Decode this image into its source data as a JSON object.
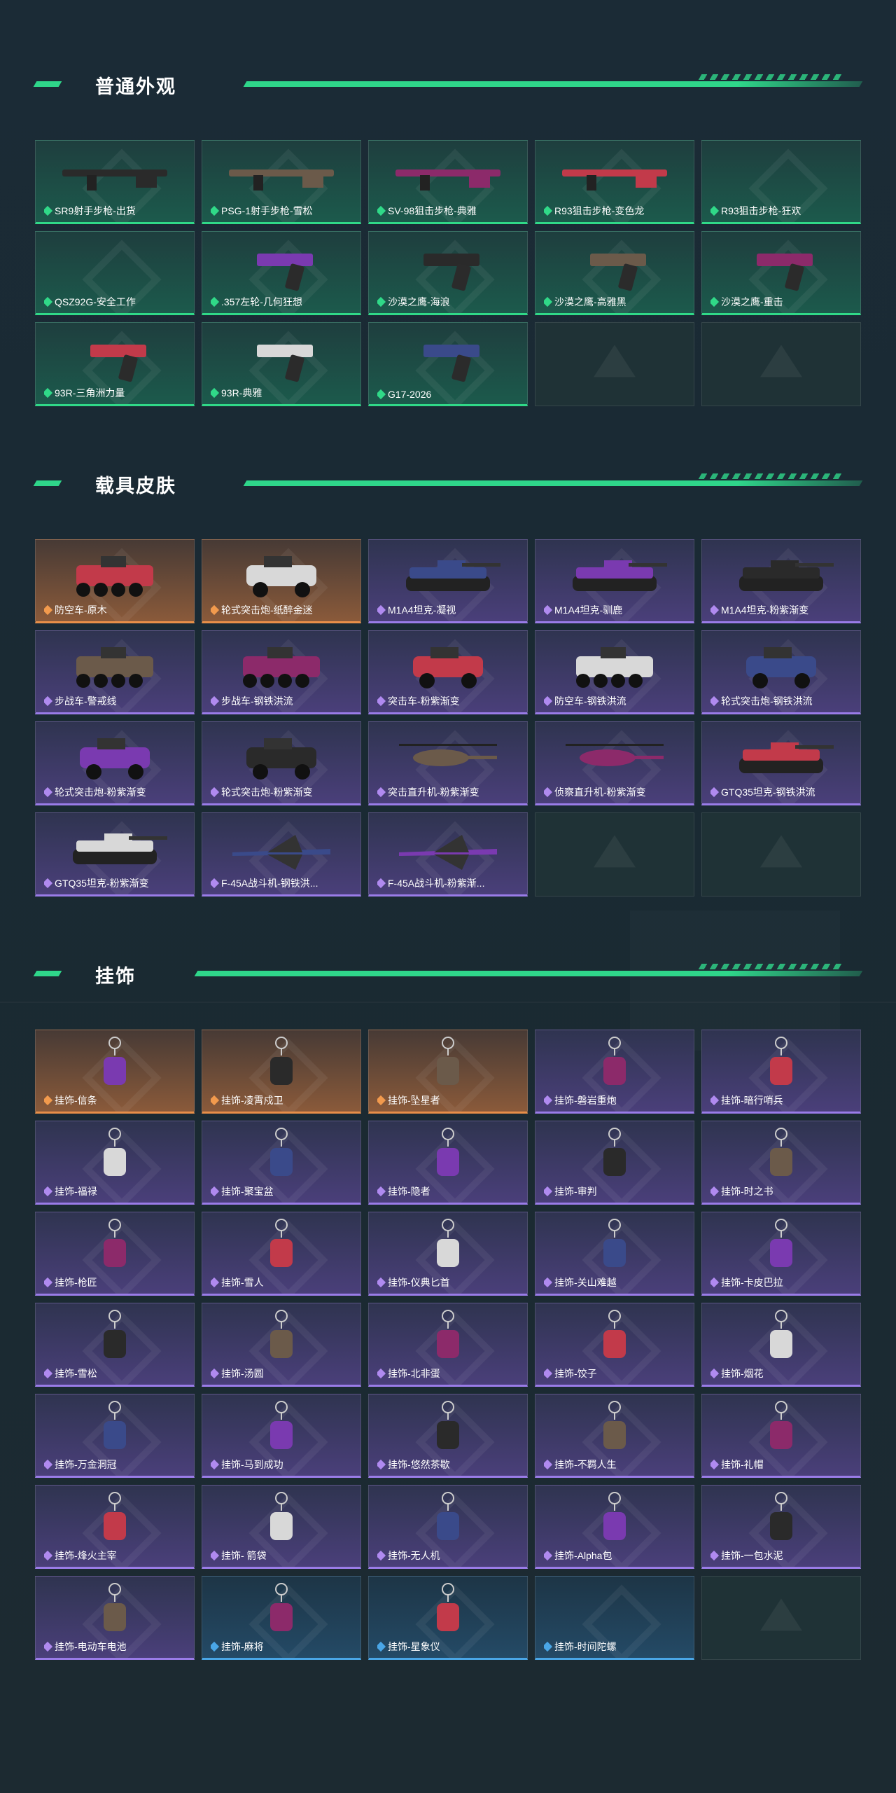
{
  "sections": [
    {
      "title": "普通外观",
      "items": [
        {
          "label": "SR9射手步枪-出货",
          "rarity": "green",
          "art": "rifle"
        },
        {
          "label": "PSG-1射手步枪-雪松",
          "rarity": "green",
          "art": "rifle"
        },
        {
          "label": "SV-98狙击步枪-典雅",
          "rarity": "green",
          "art": "rifle"
        },
        {
          "label": "R93狙击步枪-变色龙",
          "rarity": "green",
          "art": "rifle"
        },
        {
          "label": "R93狙击步枪-狂欢",
          "rarity": "green",
          "art": "none"
        },
        {
          "label": "QSZ92G-安全工作",
          "rarity": "green",
          "art": "none"
        },
        {
          "label": ".357左轮-几何狂想",
          "rarity": "green",
          "art": "pistol"
        },
        {
          "label": "沙漠之鹰-海浪",
          "rarity": "green",
          "art": "pistol"
        },
        {
          "label": "沙漠之鹰-高雅黑",
          "rarity": "green",
          "art": "pistol"
        },
        {
          "label": "沙漠之鹰-重击",
          "rarity": "green",
          "art": "pistol"
        },
        {
          "label": "93R-三角洲力量",
          "rarity": "green",
          "art": "pistol"
        },
        {
          "label": "93R-典雅",
          "rarity": "green",
          "art": "pistol"
        },
        {
          "label": "G17-2026",
          "rarity": "green",
          "art": "pistol"
        },
        {
          "label": "",
          "rarity": "empty",
          "art": "none"
        },
        {
          "label": "",
          "rarity": "empty",
          "art": "none"
        }
      ]
    },
    {
      "title": "载具皮肤",
      "items": [
        {
          "label": "防空车-原木",
          "rarity": "orange",
          "art": "apc"
        },
        {
          "label": "轮式突击炮-纸醉金迷",
          "rarity": "orange",
          "art": "car"
        },
        {
          "label": "M1A4坦克-凝视",
          "rarity": "purple",
          "art": "tank"
        },
        {
          "label": "M1A4坦克-驯鹿",
          "rarity": "purple",
          "art": "tank"
        },
        {
          "label": "M1A4坦克-粉紫渐变",
          "rarity": "purple",
          "art": "tank"
        },
        {
          "label": "步战车-警戒线",
          "rarity": "purple",
          "art": "apc"
        },
        {
          "label": "步战车-钢铁洪流",
          "rarity": "purple",
          "art": "apc"
        },
        {
          "label": "突击车-粉紫渐变",
          "rarity": "purple",
          "art": "car"
        },
        {
          "label": "防空车-钢铁洪流",
          "rarity": "purple",
          "art": "apc"
        },
        {
          "label": "轮式突击炮-钢铁洪流",
          "rarity": "purple",
          "art": "car"
        },
        {
          "label": "轮式突击炮-粉紫渐变",
          "rarity": "purple",
          "art": "car"
        },
        {
          "label": "轮式突击炮-粉紫渐变",
          "rarity": "purple",
          "art": "car"
        },
        {
          "label": "突击直升机-粉紫渐变",
          "rarity": "purple",
          "art": "heli"
        },
        {
          "label": "侦察直升机-粉紫渐变",
          "rarity": "purple",
          "art": "heli"
        },
        {
          "label": "GTQ35坦克-钢铁洪流",
          "rarity": "purple",
          "art": "tank"
        },
        {
          "label": "GTQ35坦克-粉紫渐变",
          "rarity": "purple",
          "art": "tank"
        },
        {
          "label": "F-45A战斗机-钢铁洪...",
          "rarity": "purple",
          "art": "jet"
        },
        {
          "label": "F-45A战斗机-粉紫渐...",
          "rarity": "purple",
          "art": "jet"
        },
        {
          "label": "",
          "rarity": "empty",
          "art": "none"
        },
        {
          "label": "",
          "rarity": "empty",
          "art": "none"
        }
      ]
    },
    {
      "title": "挂饰",
      "items": [
        {
          "label": "挂饰-信条",
          "rarity": "orange",
          "art": "charm"
        },
        {
          "label": "挂饰-凌霄戍卫",
          "rarity": "orange",
          "art": "charm"
        },
        {
          "label": "挂饰-坠星者",
          "rarity": "orange",
          "art": "charm"
        },
        {
          "label": "挂饰-磐岩重炮",
          "rarity": "purple",
          "art": "charm"
        },
        {
          "label": "挂饰-暗行哨兵",
          "rarity": "purple",
          "art": "charm"
        },
        {
          "label": "挂饰-福禄",
          "rarity": "purple",
          "art": "charm"
        },
        {
          "label": "挂饰-聚宝盆",
          "rarity": "purple",
          "art": "charm"
        },
        {
          "label": "挂饰-隐者",
          "rarity": "purple",
          "art": "charm"
        },
        {
          "label": "挂饰-审判",
          "rarity": "purple",
          "art": "charm"
        },
        {
          "label": "挂饰-时之书",
          "rarity": "purple",
          "art": "charm"
        },
        {
          "label": "挂饰-枪匠",
          "rarity": "purple",
          "art": "charm"
        },
        {
          "label": "挂饰-雪人",
          "rarity": "purple",
          "art": "charm"
        },
        {
          "label": "挂饰-仪典匕首",
          "rarity": "purple",
          "art": "charm"
        },
        {
          "label": "挂饰-关山难越",
          "rarity": "purple",
          "art": "charm"
        },
        {
          "label": "挂饰-卡皮巴拉",
          "rarity": "purple",
          "art": "charm"
        },
        {
          "label": "挂饰-雪松",
          "rarity": "purple",
          "art": "charm"
        },
        {
          "label": "挂饰-汤圆",
          "rarity": "purple",
          "art": "charm"
        },
        {
          "label": "挂饰-北非蛋",
          "rarity": "purple",
          "art": "charm"
        },
        {
          "label": "挂饰-饺子",
          "rarity": "purple",
          "art": "charm"
        },
        {
          "label": "挂饰-烟花",
          "rarity": "purple",
          "art": "charm"
        },
        {
          "label": "挂饰-万金洞冠",
          "rarity": "purple",
          "art": "charm"
        },
        {
          "label": "挂饰-马到成功",
          "rarity": "purple",
          "art": "charm"
        },
        {
          "label": "挂饰-悠然茶歇",
          "rarity": "purple",
          "art": "charm"
        },
        {
          "label": "挂饰-不羁人生",
          "rarity": "purple",
          "art": "charm"
        },
        {
          "label": "挂饰-礼帽",
          "rarity": "purple",
          "art": "charm"
        },
        {
          "label": "挂饰-烽火主宰",
          "rarity": "purple",
          "art": "charm"
        },
        {
          "label": "挂饰- 箭袋",
          "rarity": "purple",
          "art": "charm"
        },
        {
          "label": "挂饰-无人机",
          "rarity": "purple",
          "art": "charm"
        },
        {
          "label": "挂饰-Alpha包",
          "rarity": "purple",
          "art": "charm"
        },
        {
          "label": "挂饰-一包水泥",
          "rarity": "purple",
          "art": "charm"
        },
        {
          "label": "挂饰-电动车电池",
          "rarity": "purple",
          "art": "charm"
        },
        {
          "label": "挂饰-麻将",
          "rarity": "blue",
          "art": "charm"
        },
        {
          "label": "挂饰-星象仪",
          "rarity": "blue",
          "art": "charm"
        },
        {
          "label": "挂饰-时间陀螺",
          "rarity": "blue",
          "art": "none"
        },
        {
          "label": "",
          "rarity": "empty",
          "art": "none"
        }
      ]
    }
  ]
}
